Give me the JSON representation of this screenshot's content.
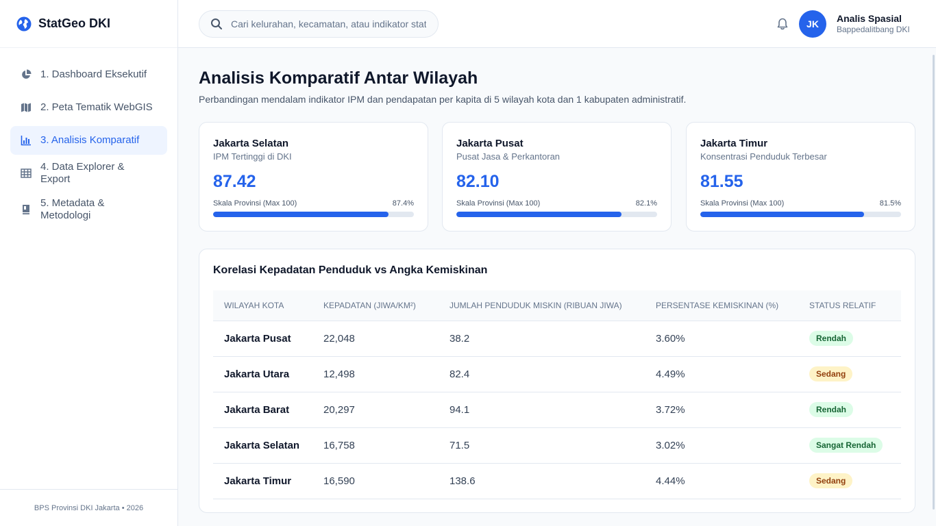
{
  "app": {
    "name": "StatGeo DKI",
    "logo_icon": "globe-icon"
  },
  "sidebar": {
    "items": [
      {
        "label": "1. Dashboard Eksekutif",
        "icon": "pie-chart-icon",
        "active": false
      },
      {
        "label": "2. Peta Tematik WebGIS",
        "icon": "map-icon",
        "active": false
      },
      {
        "label": "3. Analisis Komparatif",
        "icon": "bar-chart-icon",
        "active": true
      },
      {
        "label": "4. Data Explorer & Export",
        "icon": "table-icon",
        "active": false
      },
      {
        "label": "5. Metadata & Metodologi",
        "icon": "book-icon",
        "active": false
      }
    ],
    "footer": "BPS Provinsi DKI Jakarta • 2026"
  },
  "header": {
    "search_placeholder": "Cari kelurahan, kecamatan, atau indikator statistik...",
    "user": {
      "initials": "JK",
      "name": "Analis Spasial",
      "org": "Bappedalitbang DKI"
    }
  },
  "main": {
    "title": "Analisis Komparatif Antar Wilayah",
    "subtitle": "Perbandingan mendalam indikator IPM dan pendapatan per kapita di 5 wilayah kota dan 1 kabupaten administratif.",
    "cards": [
      {
        "region": "Jakarta Selatan",
        "desc": "IPM Tertinggi di DKI",
        "value": "87.42",
        "scale_label": "Skala Provinsi (Max 100)",
        "pct_label": "87.4%",
        "fraction": 0.874
      },
      {
        "region": "Jakarta Pusat",
        "desc": "Pusat Jasa & Perkantoran",
        "value": "82.10",
        "scale_label": "Skala Provinsi (Max 100)",
        "pct_label": "82.1%",
        "fraction": 0.821
      },
      {
        "region": "Jakarta Timur",
        "desc": "Konsentrasi Penduduk Terbesar",
        "value": "81.55",
        "scale_label": "Skala Provinsi (Max 100)",
        "pct_label": "81.5%",
        "fraction": 0.815
      }
    ],
    "table": {
      "title": "Korelasi Kepadatan Penduduk vs Angka Kemiskinan",
      "headers": [
        "WILAYAH KOTA",
        "KEPADATAN (JIWA/KM²)",
        "JUMLAH PENDUDUK MISKIN (RIBUAN JIWA)",
        "PERSENTASE KEMISKINAN (%)",
        "STATUS RELATIF"
      ],
      "rows": [
        {
          "region": "Jakarta Pusat",
          "density": "22,048",
          "poor": "38.2",
          "pct": "3.60%",
          "status": "Rendah",
          "status_color": "green"
        },
        {
          "region": "Jakarta Utara",
          "density": "12,498",
          "poor": "82.4",
          "pct": "4.49%",
          "status": "Sedang",
          "status_color": "yellow"
        },
        {
          "region": "Jakarta Barat",
          "density": "20,297",
          "poor": "94.1",
          "pct": "3.72%",
          "status": "Rendah",
          "status_color": "green"
        },
        {
          "region": "Jakarta Selatan",
          "density": "16,758",
          "poor": "71.5",
          "pct": "3.02%",
          "status": "Sangat Rendah",
          "status_color": "green"
        },
        {
          "region": "Jakarta Timur",
          "density": "16,590",
          "poor": "138.6",
          "pct": "4.44%",
          "status": "Sedang",
          "status_color": "yellow"
        }
      ]
    }
  }
}
